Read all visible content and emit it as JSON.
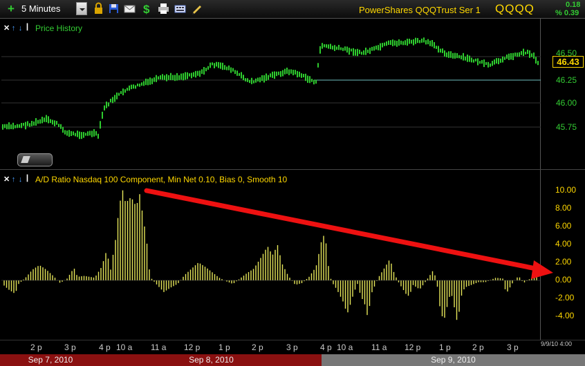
{
  "toolbar": {
    "interval": "5 Minutes",
    "symbol_name": "PowerShares QQQTrust Ser 1",
    "symbol": "QQQQ",
    "change": "0.18",
    "change_pct": "% 0.39",
    "icons": [
      "plus-icon",
      "dropdown-icon",
      "lock-icon",
      "save-icon",
      "mail-icon",
      "dollar-icon",
      "print-icon",
      "keyboard-icon",
      "pencil-icon"
    ]
  },
  "price_panel": {
    "title": "Price History",
    "last_price": "46.43",
    "y_ticks": [
      "46.50",
      "46.25",
      "46.00",
      "45.75"
    ]
  },
  "ad_panel": {
    "title": "A/D Ratio Nasdaq 100 Component, Min Net 0.10, Bias 0, Smooth 10",
    "y_ticks": [
      "10.00",
      "8.00",
      "6.00",
      "4.00",
      "2.00",
      "0.00",
      "-2.00",
      "-4.00"
    ]
  },
  "time_axis": {
    "labels": [
      "2 p",
      "3 p",
      "4 p",
      "10 a",
      "11 a",
      "12 p",
      "1 p",
      "2 p",
      "3 p",
      "4 p",
      "10 a",
      "11 a",
      "12 p",
      "1 p",
      "2 p",
      "3 p"
    ],
    "stamp": "9/9/10 4:00"
  },
  "dates": [
    "Sep 7, 2010",
    "Sep 8, 2010",
    "Sep 9, 2010"
  ],
  "colors": {
    "price_up": "#2ecc2e",
    "histogram": "#e8e85a",
    "arrow": "#ee1111",
    "label_yellow": "#ffd800",
    "date_bar_dark": "#8a1010",
    "date_bar_light": "#777777"
  },
  "annotation": {
    "arrow_direction": "downward trend arrow from Sep 8 morning peak to latest bar"
  }
}
